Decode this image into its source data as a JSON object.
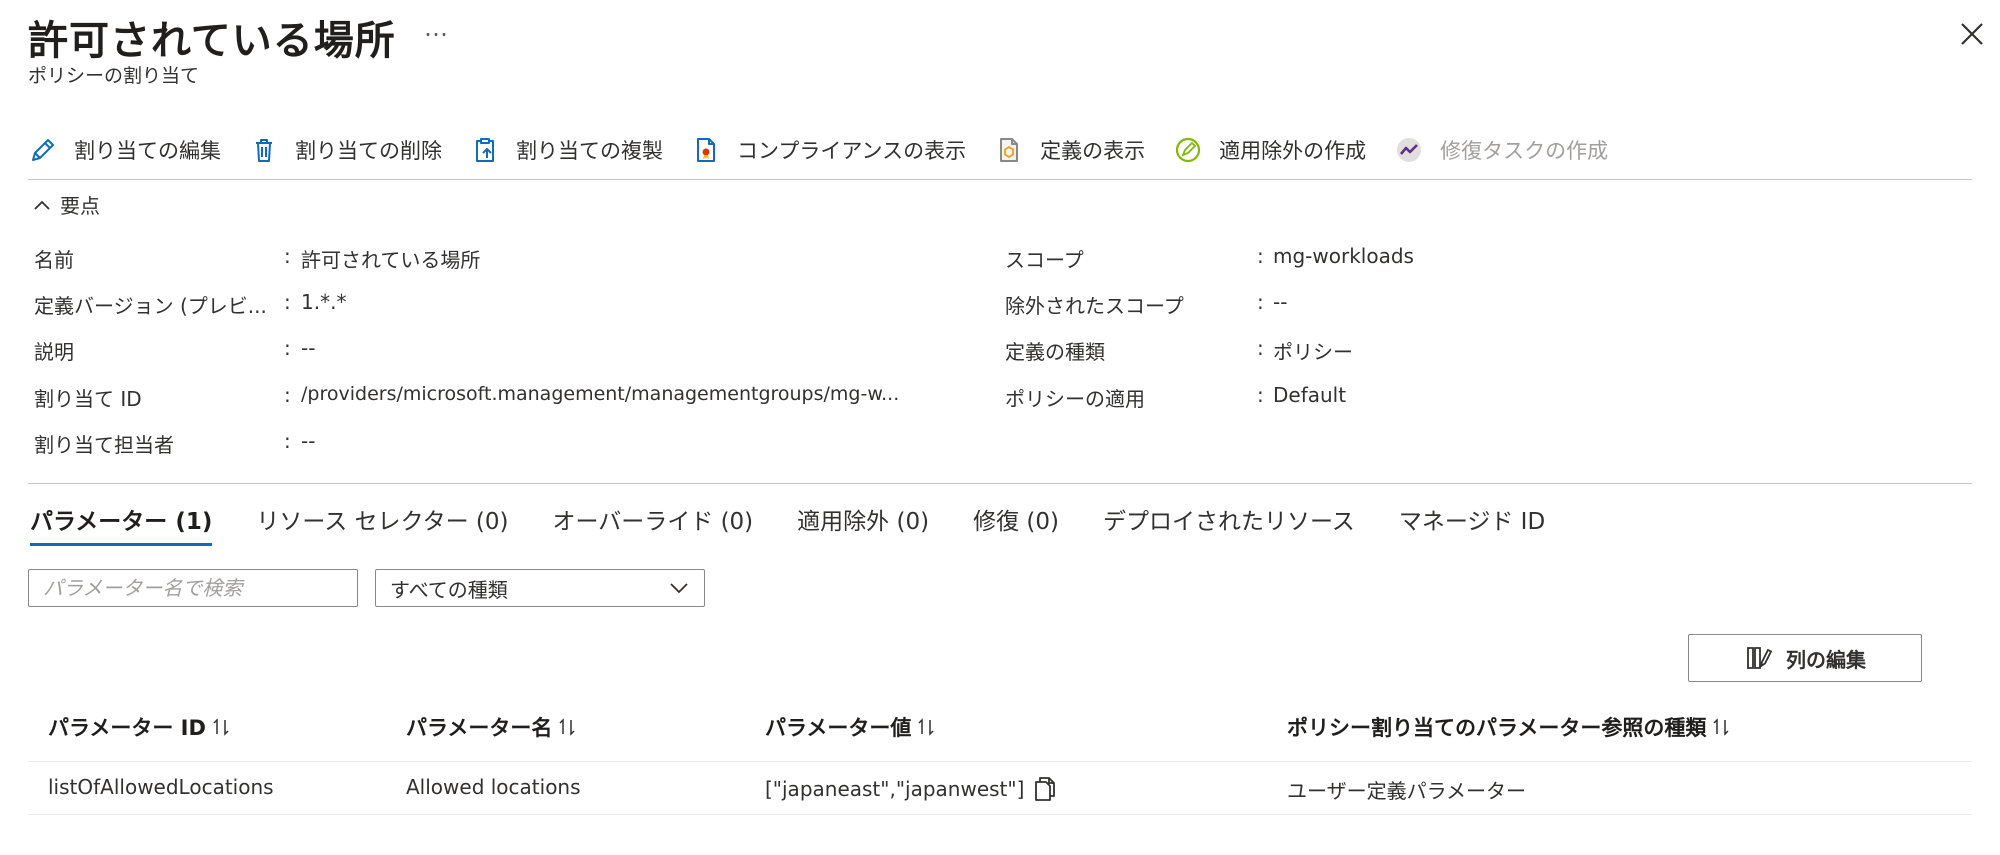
{
  "header": {
    "title": "許可されている場所",
    "subtitle": "ポリシーの割り当て",
    "more": "…"
  },
  "toolbar": {
    "edit": "割り当ての編集",
    "delete": "割り当ての削除",
    "duplicate": "割り当ての複製",
    "compliance": "コンプライアンスの表示",
    "definition": "定義の表示",
    "exemption": "適用除外の作成",
    "remediation": "修復タスクの作成"
  },
  "essentials": {
    "toggle": "要点",
    "colon": ":",
    "left": [
      {
        "label": "名前",
        "value": "許可されている場所"
      },
      {
        "label": "定義バージョン (プレビ...",
        "value": "1.*.*"
      },
      {
        "label": "説明",
        "value": "--"
      },
      {
        "label": "割り当て ID",
        "value": "/providers/microsoft.management/managementgroups/mg-w..."
      },
      {
        "label": "割り当て担当者",
        "value": "--"
      }
    ],
    "right": [
      {
        "label": "スコープ",
        "value": "mg-workloads"
      },
      {
        "label": "除外されたスコープ",
        "value": "--"
      },
      {
        "label": "定義の種類",
        "value": "ポリシー"
      },
      {
        "label": "ポリシーの適用",
        "value": "Default"
      }
    ]
  },
  "tabs": [
    {
      "label": "パラメーター (1)"
    },
    {
      "label": "リソース セレクター (0)"
    },
    {
      "label": "オーバーライド (0)"
    },
    {
      "label": "適用除外 (0)"
    },
    {
      "label": "修復 (0)"
    },
    {
      "label": "デプロイされたリソース"
    },
    {
      "label": "マネージド ID"
    }
  ],
  "filters": {
    "search_placeholder": "パラメーター名で検索",
    "type_selected": "すべての種類"
  },
  "edit_columns": "列の編集",
  "table": {
    "headers": [
      "パラメーター ID",
      "パラメーター名",
      "パラメーター値",
      "ポリシー割り当てのパラメーター参照の種類"
    ],
    "rows": [
      [
        "listOfAllowedLocations",
        "Allowed locations",
        "[\"japaneast\",\"japanwest\"]",
        "ユーザー定義パラメーター"
      ]
    ]
  },
  "colors": {
    "accent": "#0f6cbd",
    "text": "#323130",
    "disabled": "#a19f9d"
  }
}
